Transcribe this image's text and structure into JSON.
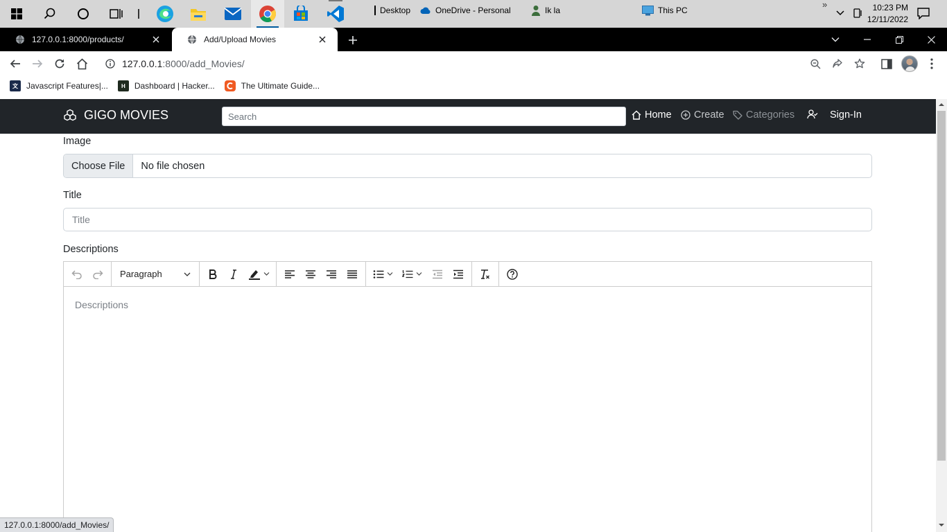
{
  "taskbar": {
    "items": [
      {
        "name": "Desktop"
      },
      {
        "name": "OneDrive - Personal"
      },
      {
        "name": "Ik la"
      },
      {
        "name": "This PC"
      }
    ],
    "overflow": "»",
    "clock": {
      "time": "10:23 PM",
      "date": "12/11/2022"
    }
  },
  "tabs": [
    {
      "title": "127.0.0.1:8000/products/",
      "active": false
    },
    {
      "title": "Add/Upload Movies",
      "active": true
    }
  ],
  "address_bar": {
    "host": "127.0.0.1",
    "path": ":8000/add_Movies/"
  },
  "bookmarks": [
    {
      "label": "Javascript Features|...",
      "icon": "translate-icon",
      "color": "#1a2a4a"
    },
    {
      "label": "Dashboard | Hacker...",
      "icon": "hackerrank-icon",
      "color": "#1e2a1e",
      "icon_text": "H"
    },
    {
      "label": "The Ultimate Guide...",
      "icon": "codedamn-icon",
      "color": "#f05a22"
    }
  ],
  "page": {
    "brand": "GIGO MOVIES",
    "search_placeholder": "Search",
    "nav": {
      "home": "Home",
      "create": "Create",
      "categories": "Categories",
      "signin": "Sign-In"
    },
    "form": {
      "image_label": "Image",
      "file_button": "Choose File",
      "file_status": "No file chosen",
      "title_label": "Title",
      "title_placeholder": "Title",
      "descriptions_label": "Descriptions",
      "block_format": "Paragraph",
      "editor_placeholder": "Descriptions"
    }
  },
  "status_url": "127.0.0.1:8000/add_Movies/",
  "colors": {
    "navbar": "#212529",
    "taskbar": "#d6d6d6",
    "tabstrip": "#000000"
  }
}
